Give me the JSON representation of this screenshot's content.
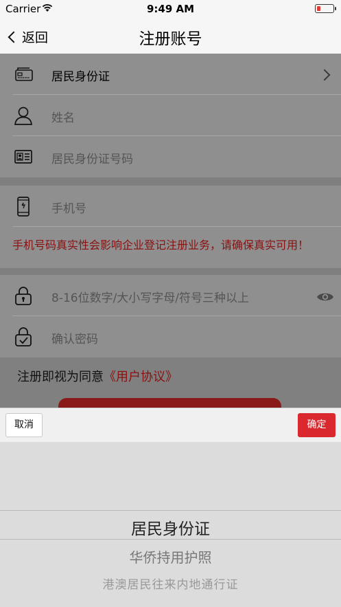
{
  "status_bar": {
    "carrier": "Carrier",
    "time": "9:49 AM",
    "wifi_icon": "wifi-icon",
    "battery_icon": "battery-low-icon"
  },
  "nav": {
    "back_label": "返回",
    "title": "注册账号"
  },
  "form": {
    "id_type": {
      "value": "居民身份证",
      "icon": "id-card-icon"
    },
    "name": {
      "placeholder": "姓名",
      "icon": "person-icon"
    },
    "id_number": {
      "placeholder": "居民身份证号码",
      "icon": "contact-card-icon"
    },
    "phone": {
      "placeholder": "手机号",
      "icon": "phone-icon"
    },
    "phone_warning": "手机号码真实性会影响企业登记注册业务，请确保真实可用！",
    "password": {
      "placeholder": "8-16位数字/大小写字母/符号三种以上",
      "icon": "lock-icon",
      "toggle_icon": "eye-icon"
    },
    "confirm_password": {
      "placeholder": "确认密码",
      "icon": "lock-check-icon"
    },
    "agreement_prefix": "注册即视为同意",
    "agreement_link": "《用户协议》"
  },
  "picker": {
    "cancel_label": "取消",
    "confirm_label": "确定",
    "options": [
      "居民身份证",
      "华侨持用护照",
      "港澳居民往来内地通行证"
    ],
    "selected_index": 0
  },
  "colors": {
    "accent_red": "#d9292f",
    "warning_text": "#8a1111"
  }
}
